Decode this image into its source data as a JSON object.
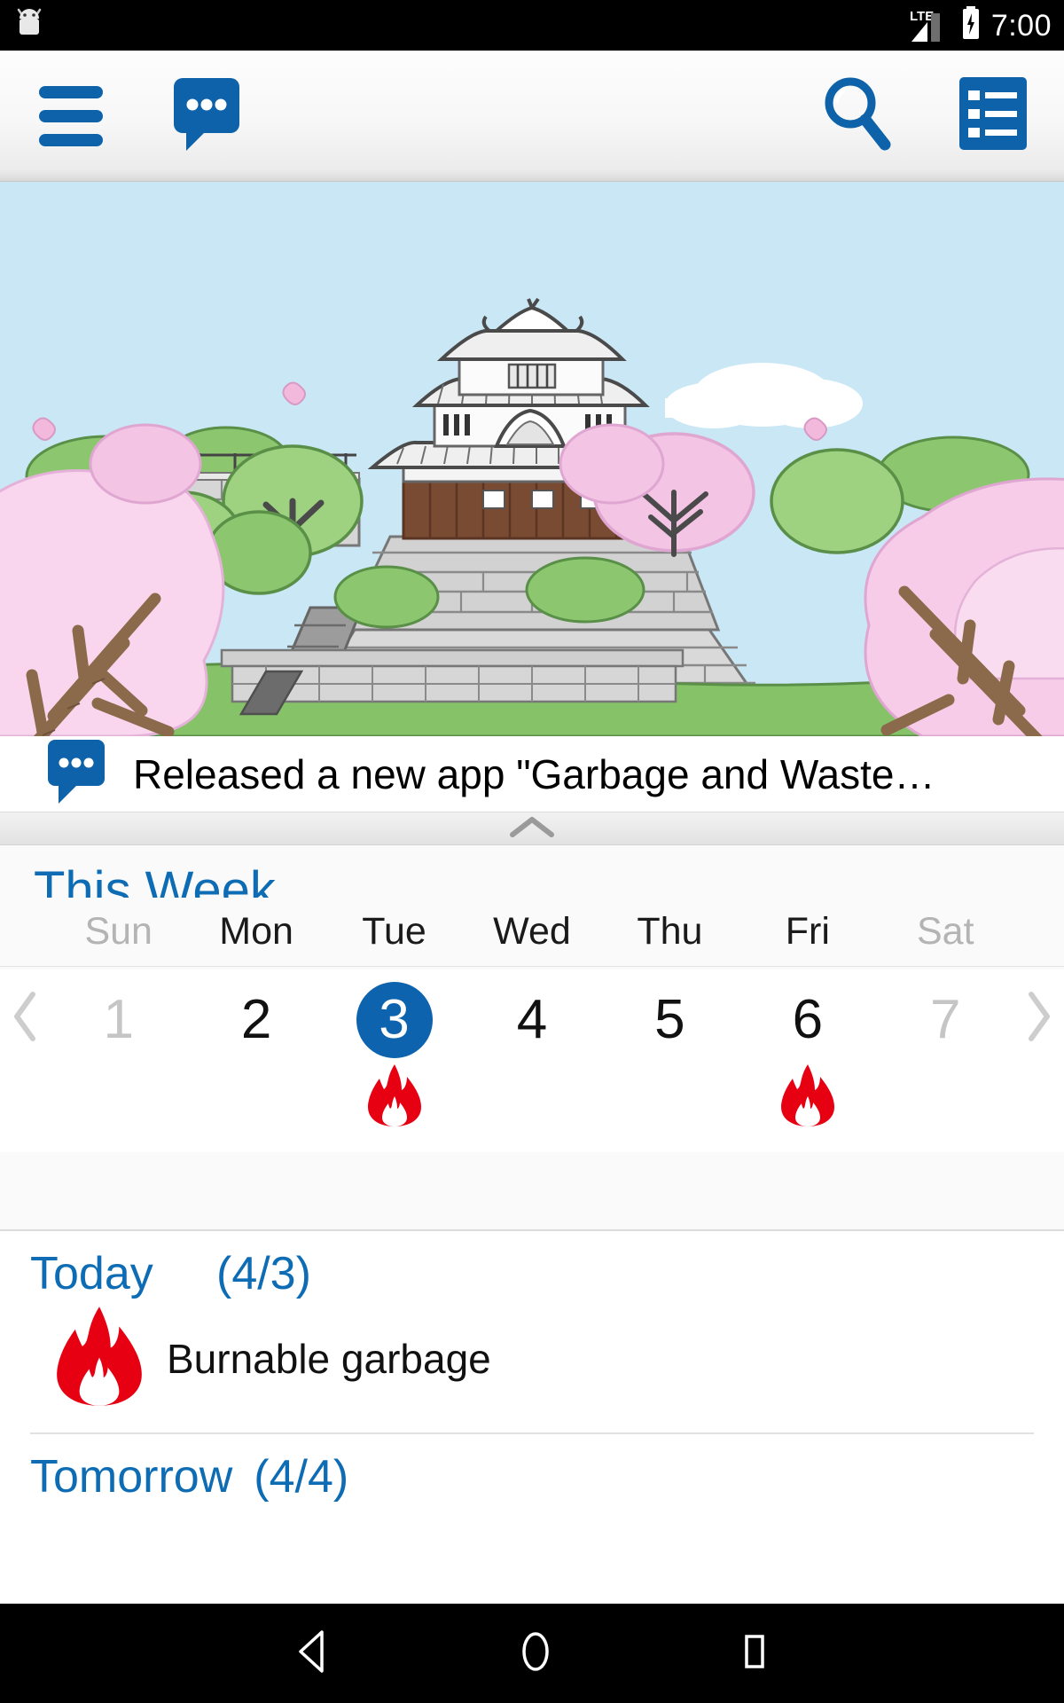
{
  "statusbar": {
    "app_icon": "android-robot-icon",
    "network_label": "LTE",
    "signal_icon": "signal-bars-icon",
    "battery_icon": "battery-charging-icon",
    "clock": "7:00"
  },
  "toolbar": {
    "menu_icon": "hamburger-menu-icon",
    "news_icon": "speech-bubble-icon",
    "search_icon": "magnifier-icon",
    "list_icon": "list-menu-icon",
    "accent_color": "#0e62aa"
  },
  "hero": {
    "alt": "japanese-castle-cherry-blossom-illustration",
    "sky_color": "#c9e7f4",
    "blossom_color": "#f6cce8",
    "tree_color": "#8cc76f",
    "stone_color": "#d6d6d6"
  },
  "news": {
    "icon": "speech-bubble-icon",
    "text": "Released a new app \"Garbage and Waste…"
  },
  "handle": {
    "icon": "chevron-up-icon"
  },
  "week": {
    "title": "This Week",
    "prev_icon": "chevron-left-icon",
    "next_icon": "chevron-right-icon",
    "selected_color": "#0d63ad",
    "flame_color": "#e60012",
    "days": [
      {
        "dow": "Sun",
        "num": "1",
        "muted": true,
        "selected": false,
        "mark": ""
      },
      {
        "dow": "Mon",
        "num": "2",
        "muted": false,
        "selected": false,
        "mark": ""
      },
      {
        "dow": "Tue",
        "num": "3",
        "muted": false,
        "selected": true,
        "mark": "flame-icon"
      },
      {
        "dow": "Wed",
        "num": "4",
        "muted": false,
        "selected": false,
        "mark": ""
      },
      {
        "dow": "Thu",
        "num": "5",
        "muted": false,
        "selected": false,
        "mark": ""
      },
      {
        "dow": "Fri",
        "num": "6",
        "muted": false,
        "selected": false,
        "mark": "flame-icon"
      },
      {
        "dow": "Sat",
        "num": "7",
        "muted": true,
        "selected": false,
        "mark": ""
      }
    ]
  },
  "schedule": [
    {
      "label": "Today",
      "date": "(4/3)",
      "items": [
        {
          "icon": "flame-icon",
          "text": "Burnable garbage"
        }
      ]
    },
    {
      "label": "Tomorrow",
      "date": "(4/4)",
      "items": []
    }
  ],
  "navbar": {
    "back_icon": "back-triangle-icon",
    "home_icon": "home-circle-icon",
    "recents_icon": "recents-square-icon"
  }
}
